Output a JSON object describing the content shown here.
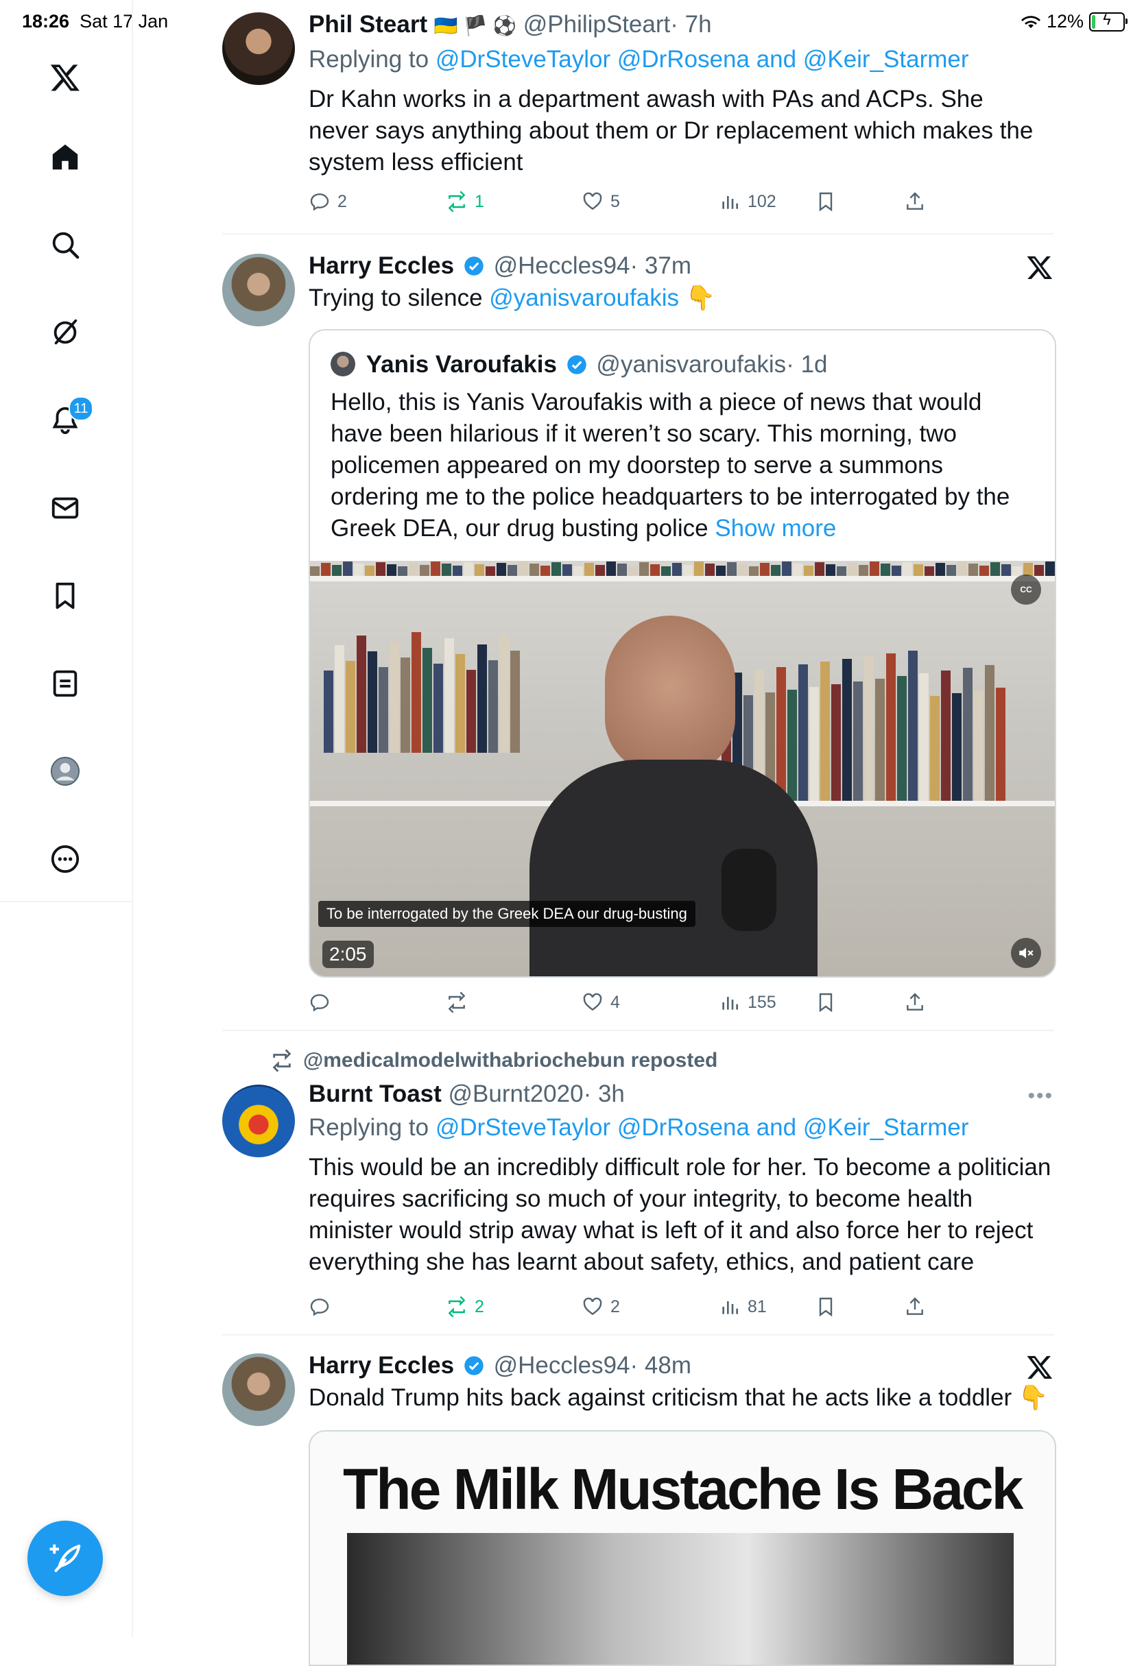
{
  "status_bar": {
    "time": "18:26",
    "date": "Sat 17 Jan",
    "battery": "12%",
    "battery_fraction": 0.12
  },
  "sidebar": {
    "items": [
      {
        "name": "x-logo-icon"
      },
      {
        "name": "home-icon"
      },
      {
        "name": "search-icon"
      },
      {
        "name": "grok-icon"
      },
      {
        "name": "notifications-icon",
        "badge": "11"
      },
      {
        "name": "messages-icon"
      },
      {
        "name": "bookmarks-icon"
      },
      {
        "name": "lists-icon"
      },
      {
        "name": "profile-avatar-icon"
      },
      {
        "name": "more-icon"
      }
    ],
    "compose_icon": "feather-plus-icon"
  },
  "tweets": [
    {
      "name": "Phil Steart",
      "flags": "🇺🇦 🏴 ⚽",
      "handle": "@PhilipSteart",
      "time": "· 7h",
      "reply_prefix": "Replying to ",
      "reply_targets": "@DrSteveTaylor @DrRosena and @Keir_Starmer",
      "text": "Dr Kahn works in a department awash with PAs and ACPs. She never says anything about them or Dr replacement which makes the system less efficient",
      "replies": "2",
      "reposts": "1",
      "likes": "5",
      "views": "102"
    },
    {
      "name": "Harry Eccles",
      "handle": "@Heccles94",
      "time": "· 37m",
      "text_prefix": "Trying to silence ",
      "text_mention": "@yanisvaroufakis",
      "text_emoji": "👇",
      "quote": {
        "name": "Yanis Varoufakis",
        "handle": "@yanisvaroufakis",
        "time": "· 1d",
        "text": "Hello, this is Yanis Varoufakis with a piece of news that would have been hilarious if it weren’t so scary. This morning, two policemen appeared on my doorstep to serve a summons ordering me to the police headquarters to be interrogated by the Greek DEA, our drug busting police",
        "show_more": "Show more",
        "video_caption": "To be interrogated by the Greek DEA our drug-busting",
        "duration": "2:05",
        "cc": "CC"
      },
      "replies": "",
      "reposts": "",
      "likes": "4",
      "views": "155"
    },
    {
      "repost_label": "@medicalmodelwithabriochebun reposted",
      "name": "Burnt Toast",
      "handle": "@Burnt2020",
      "time": "· 3h",
      "reply_prefix": "Replying to ",
      "reply_targets": "@DrSteveTaylor @DrRosena and @Keir_Starmer",
      "text": "This would be an incredibly difficult role for her. To become a politician requires sacrificing so much of your integrity, to become health minister would strip away what is left of it and also force her to reject everything she has learnt about safety, ethics, and patient care",
      "replies": "",
      "reposts": "2",
      "likes": "2",
      "views": "81"
    },
    {
      "name": "Harry Eccles",
      "handle": "@Heccles94",
      "time": "· 48m",
      "text": "Donald Trump hits back against criticism that he acts like a toddler",
      "text_emoji": "👇",
      "image_title": "The Milk Mustache Is Back"
    }
  ]
}
